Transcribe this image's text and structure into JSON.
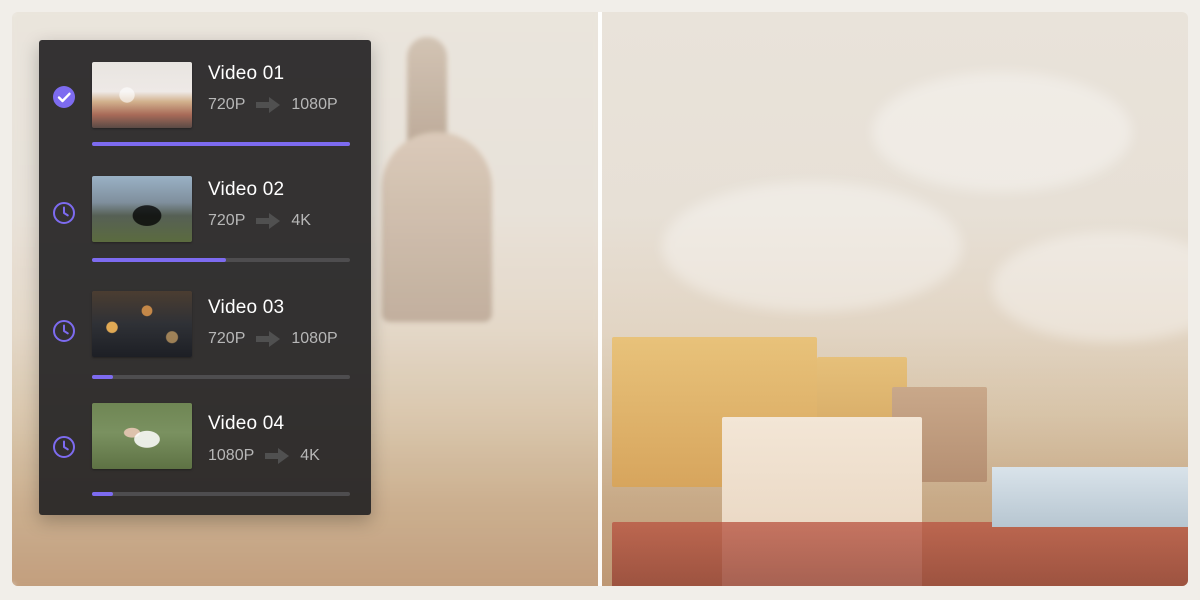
{
  "ui": {
    "accent_color": "#7d6bf0",
    "panel_background": "#242324",
    "text_primary": "#ffffff",
    "text_secondary": "#b7b7b7"
  },
  "videos": [
    {
      "title": "Video 01",
      "from_resolution": "720P",
      "to_resolution": "1080P",
      "status_icon": "check-circle-icon",
      "progress_fraction": 1.0
    },
    {
      "title": "Video 02",
      "from_resolution": "720P",
      "to_resolution": "4K",
      "status_icon": "clock-icon",
      "progress_fraction": 0.52
    },
    {
      "title": "Video 03",
      "from_resolution": "720P",
      "to_resolution": "1080P",
      "status_icon": "clock-icon",
      "progress_fraction": 0.08
    },
    {
      "title": "Video 04",
      "from_resolution": "1080P",
      "to_resolution": "4K",
      "status_icon": "clock-icon",
      "progress_fraction": 0.08
    }
  ]
}
